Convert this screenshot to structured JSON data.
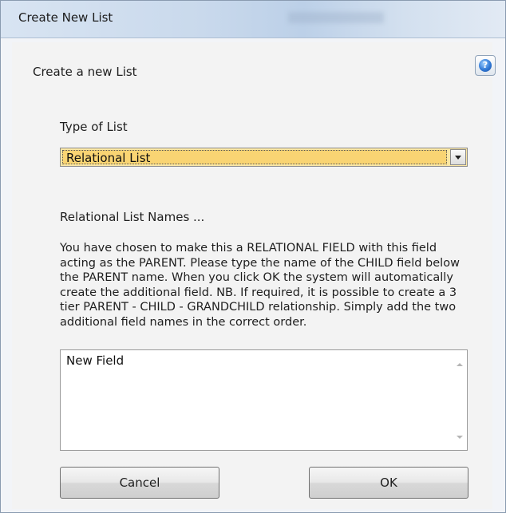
{
  "window": {
    "title": "Create New List"
  },
  "dialog": {
    "heading": "Create a new List",
    "help_icon": "help-globe-icon",
    "type_label": "Type of List",
    "type_select": {
      "selected": "Relational List"
    },
    "names_label": "Relational List Names ...",
    "description": "You have chosen to make this a RELATIONAL FIELD with this field acting as the PARENT. Please type the name of the CHILD field below the PARENT name. When you click OK the system will automatically create the additional field. NB. If required, it is possible to create a 3 tier PARENT -  CHILD - GRANDCHILD relationship. Simply add the two additional field names in the correct order.",
    "names_textarea": {
      "value": "New Field"
    },
    "cancel_label": "Cancel",
    "ok_label": "OK"
  },
  "colors": {
    "select_highlight": "#f9d473",
    "title_bar": "#c9d9ec"
  }
}
